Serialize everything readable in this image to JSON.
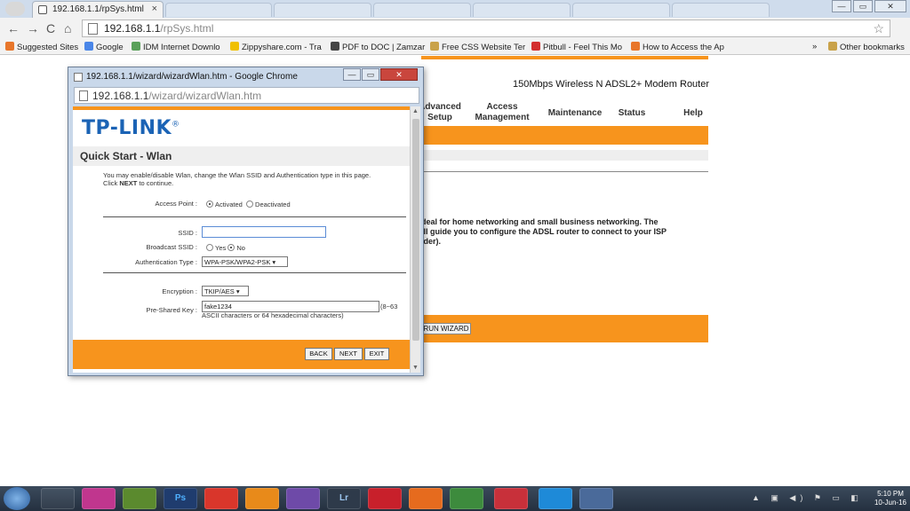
{
  "browser": {
    "tab_title": "192.168.1.1/rpSys.html",
    "tab_close": "×",
    "url_host": "192.168.1.1",
    "url_path": "/rpSys.html",
    "window_controls": [
      "—",
      "▭",
      "✕"
    ],
    "star": "☆",
    "menu": "≡",
    "nav": {
      "back": "←",
      "forward": "→",
      "reload": "C",
      "home": "⌂"
    }
  },
  "bookmarks": {
    "items": [
      {
        "label": "Suggested Sites",
        "color": "#e8762b"
      },
      {
        "label": "Google",
        "color": "#4a86e8"
      },
      {
        "label": "IDM Internet Downlo",
        "color": "#5aa05a"
      },
      {
        "label": "Zippyshare.com - Tra",
        "color": "#f0c000"
      },
      {
        "label": "PDF to DOC | Zamzar",
        "color": "#444444"
      },
      {
        "label": "Free CSS Website Ter",
        "color": "#c9a24a"
      },
      {
        "label": "Pitbull - Feel This Mo",
        "color": "#d32f2f"
      },
      {
        "label": "How to Access the Ap",
        "color": "#e8762b"
      }
    ],
    "more": "»",
    "other": "Other bookmarks"
  },
  "router_page": {
    "model": "150Mbps Wireless N ADSL2+ Modem Router",
    "nav": [
      "Advanced Setup",
      "Access Management",
      "Maintenance",
      "Status",
      "Help"
    ],
    "intro_lines": [
      "deal for home networking and small business networking. The",
      "ill guide you to configure the ADSL router to connect to your ISP",
      "ider)."
    ],
    "run_wizard": "RUN WIZARD"
  },
  "popup": {
    "title": "192.168.1.1/wizard/wizardWlan.htm - Google Chrome",
    "url_host": "192.168.1.1",
    "url_path": "/wizard/wizardWlan.htm",
    "controls": [
      "—",
      "▭",
      "✕"
    ],
    "logo": "TP-LINK",
    "logo_mark": "®",
    "heading": "Quick Start - Wlan",
    "desc_line1": "You may enable/disable Wlan, change the Wlan SSID and Authentication type in this page.",
    "desc_line2_prefix": "Click ",
    "desc_line2_bold": "NEXT",
    "desc_line2_suffix": " to continue.",
    "access_point_label": "Access Point :",
    "access_point_options": [
      "Activated",
      "Deactivated"
    ],
    "ssid_label": "SSID :",
    "ssid_value": "",
    "broadcast_label": "Broadcast SSID :",
    "broadcast_options": [
      "Yes",
      "No"
    ],
    "auth_label": "Authentication Type :",
    "auth_value": "WPA-PSK/WPA2-PSK",
    "encryption_label": "Encryption :",
    "encryption_value": "TKIP/AES",
    "psk_label": "Pre-Shared Key :",
    "psk_value": "fake1234",
    "psk_hint": "(8~63",
    "psk_hint2": "ASCII characters or 64 hexadecimal characters)",
    "buttons": {
      "back": "BACK",
      "next": "NEXT",
      "exit": "EXIT"
    }
  },
  "taskbar": {
    "apps": [
      "",
      "",
      "",
      "Ps",
      "",
      "",
      "",
      "Lr",
      "",
      "",
      "",
      "",
      "",
      ""
    ],
    "time": "5:10 PM",
    "date": "10-Jun-16"
  }
}
